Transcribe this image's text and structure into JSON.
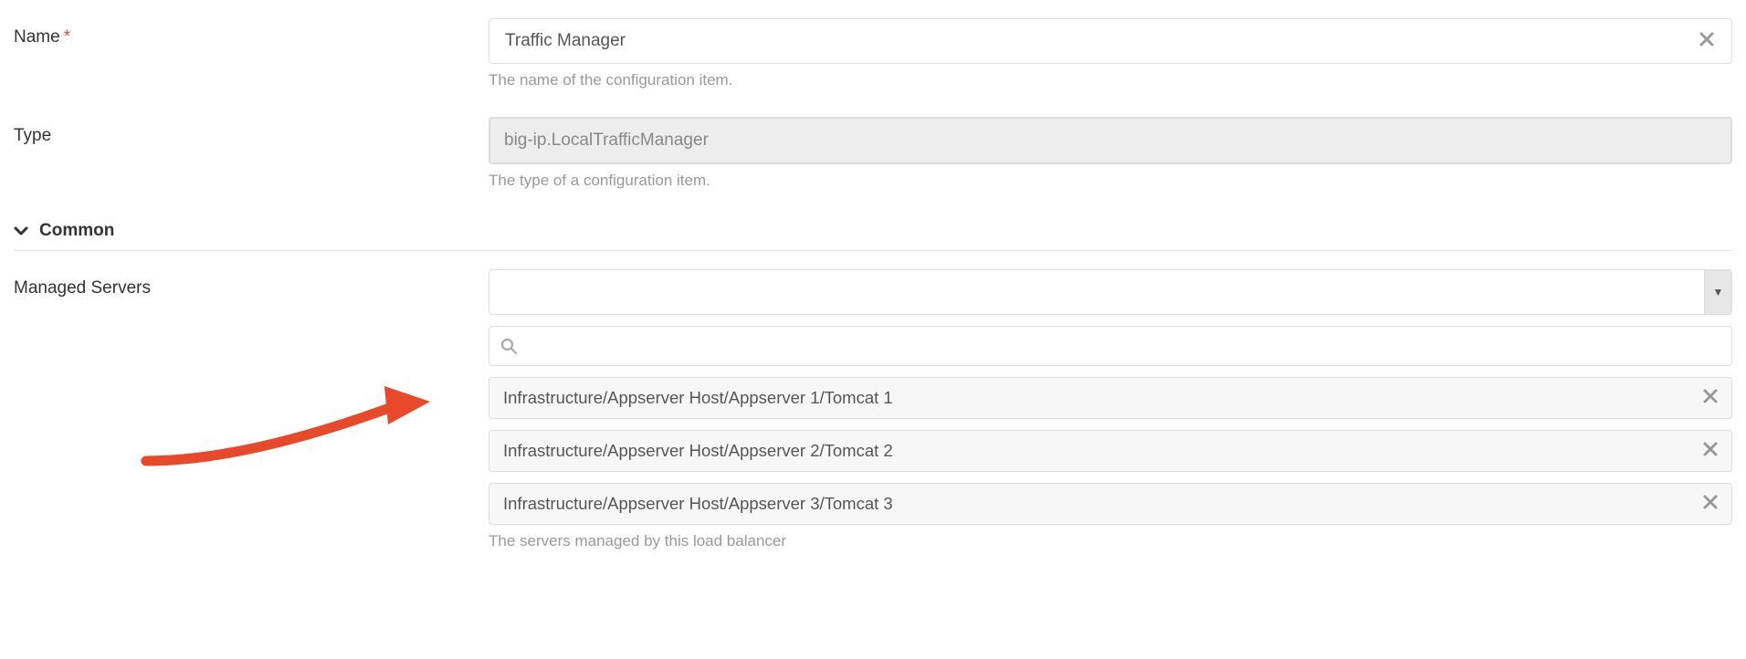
{
  "fields": {
    "name": {
      "label": "Name",
      "required": true,
      "value": "Traffic Manager",
      "help": "The name of the configuration item."
    },
    "type": {
      "label": "Type",
      "value": "big-ip.LocalTrafficManager",
      "help": "The type of a configuration item."
    }
  },
  "section": {
    "title": "Common"
  },
  "managed_servers": {
    "label": "Managed Servers",
    "select_value": "",
    "search_value": "",
    "items": [
      "Infrastructure/Appserver Host/Appserver 1/Tomcat 1",
      "Infrastructure/Appserver Host/Appserver 2/Tomcat 2",
      "Infrastructure/Appserver Host/Appserver 3/Tomcat 3"
    ],
    "help": "The servers managed by this load balancer"
  }
}
